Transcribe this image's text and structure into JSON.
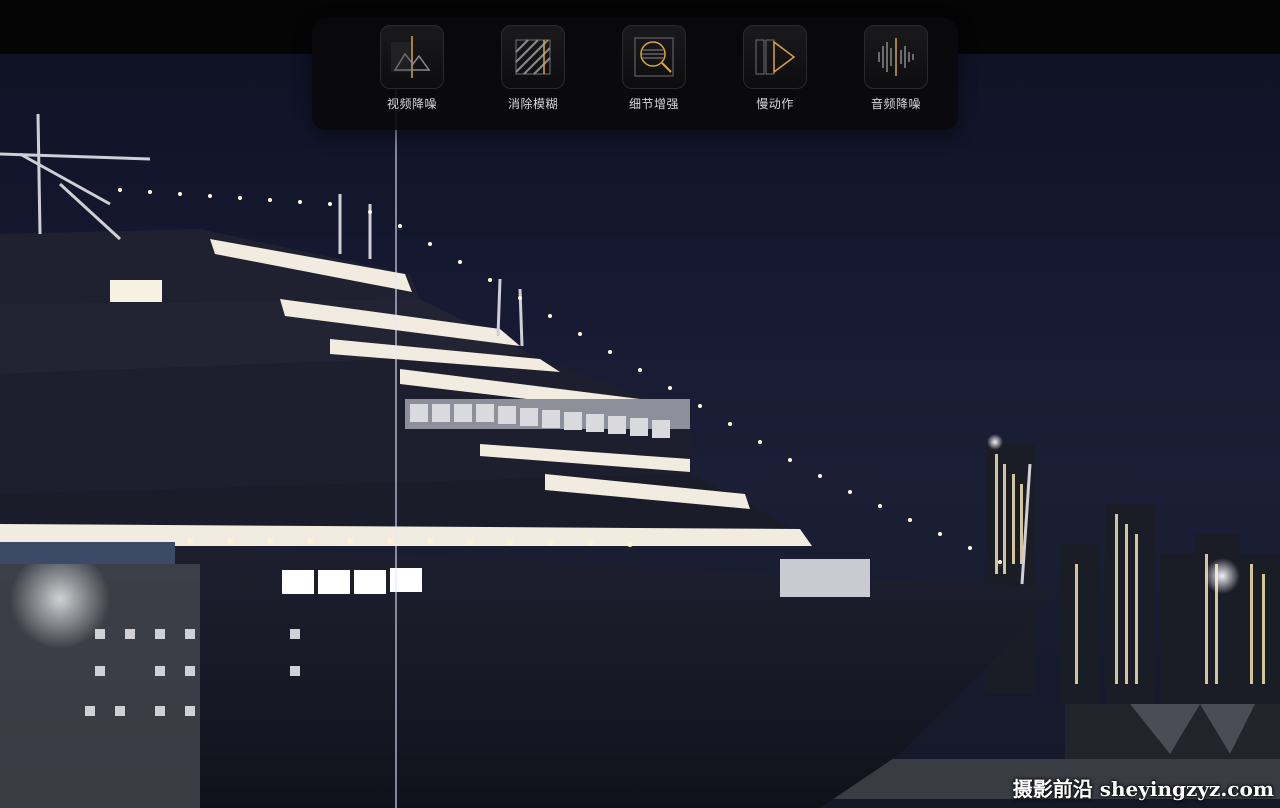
{
  "tools": [
    {
      "label": "视频降噪",
      "icon": "video-denoise-icon"
    },
    {
      "label": "消除模糊",
      "icon": "deblur-icon"
    },
    {
      "label": "细节增强",
      "icon": "detail-enhance-icon"
    },
    {
      "label": "慢动作",
      "icon": "slow-motion-icon"
    },
    {
      "label": "音频降噪",
      "icon": "audio-denoise-icon"
    }
  ],
  "watermark": "摄影前沿 sheyingzyz.com",
  "colors": {
    "accent": "#d9a441",
    "panel": "#0a0a0c",
    "sky": "#151932"
  }
}
